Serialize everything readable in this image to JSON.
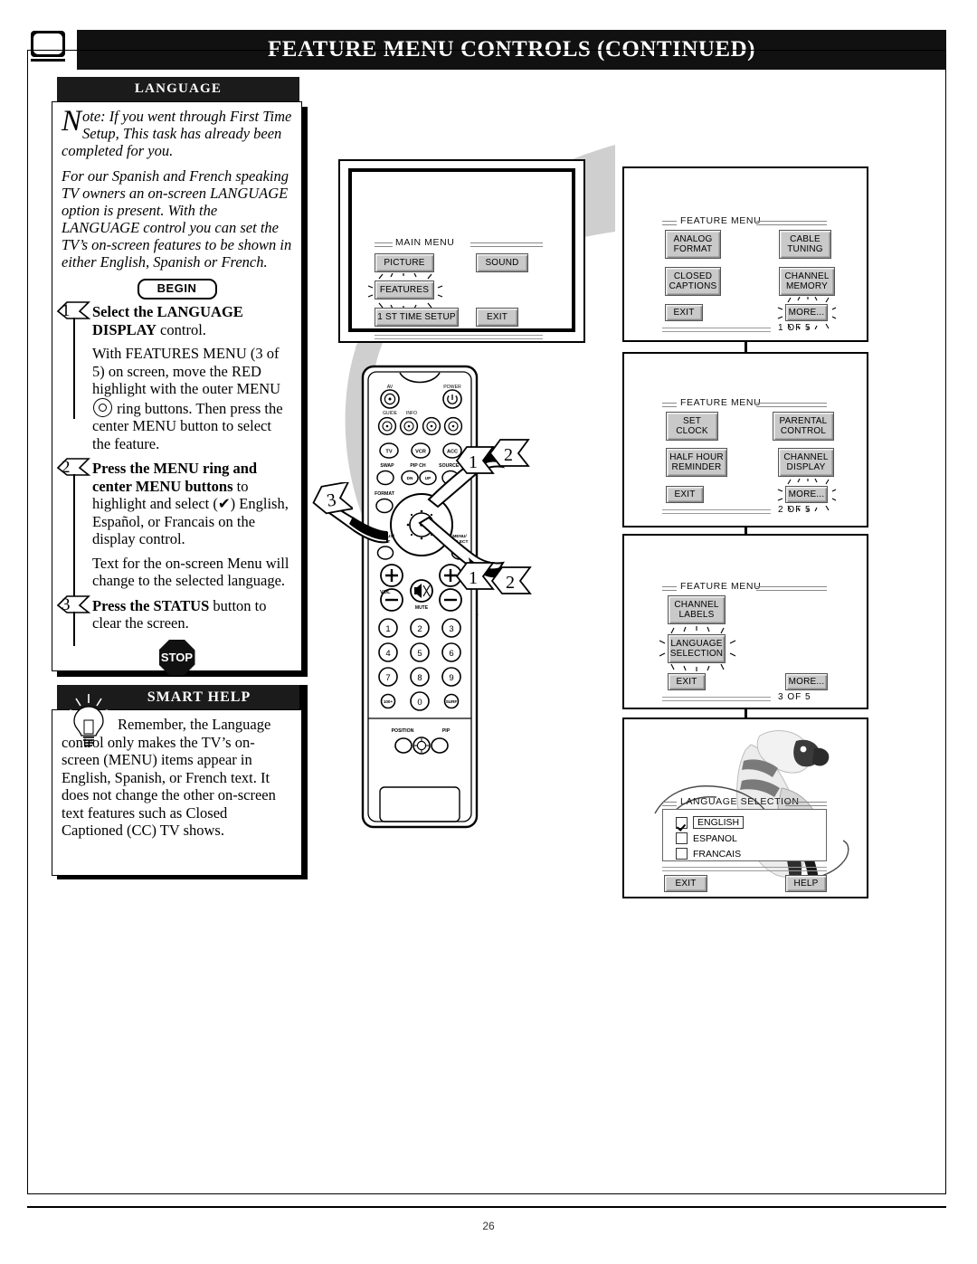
{
  "page": {
    "number": "26",
    "header_title": "FEATURE MENU CONTROLS (CONTINUED)",
    "corner_icon": "tv-icon"
  },
  "language_panel": {
    "title": "LANGUAGE",
    "note_dropcap": "N",
    "note_text": "ote: If you went through First Time Setup, This task has already been completed for you.",
    "intro_text": "For our Spanish and French speaking TV owners an on-screen LANGUAGE option is present. With the LANGUAGE control you can set the TV’s on-screen features to be shown in either English, Spanish or French.",
    "begin_label": "BEGIN",
    "stop_label": "STOP",
    "steps": [
      {
        "number": "1",
        "heading_bold": "Select the LANGUAGE DISPLAY",
        "heading_rest": " control.",
        "body_a": "With FEATURES MENU (3 of 5) on screen, move the RED highlight with the outer MENU ",
        "body_b": " ring buttons. Then press the center MENU button to select the feature."
      },
      {
        "number": "2",
        "heading_bold": "Press the MENU ring and center MENU buttons",
        "heading_rest": " to highlight and select (✔) English, Español, or Francais on the display control.",
        "body_a": "Text for the on-screen Menu will change to the selected language.",
        "body_b": ""
      },
      {
        "number": "3",
        "heading_bold": "Press the STATUS",
        "heading_rest": " button to clear the screen.",
        "body_a": "",
        "body_b": ""
      }
    ]
  },
  "smart_help": {
    "title": "SMART HELP",
    "icon": "lightbulb-icon",
    "text": "Remember, the Language control only makes the TV’s on-screen (MENU) items appear in English, Spanish, or French text. It does not change the other on-screen text features such as Closed Captioned (CC) TV shows."
  },
  "screens": {
    "main_menu": {
      "title": "MAIN MENU",
      "buttons": [
        {
          "label": "PICTURE",
          "highlighted": false
        },
        {
          "label": "SOUND",
          "highlighted": false
        },
        {
          "label": "FEATURES",
          "highlighted": true
        },
        {
          "label": "1 ST TIME SETUP",
          "highlighted": false
        },
        {
          "label": "EXIT",
          "highlighted": false
        }
      ]
    },
    "feature_menu_1": {
      "title": "FEATURE MENU",
      "page_indicator": "1 OF 5",
      "buttons": [
        {
          "label": "ANALOG FORMAT",
          "highlighted": false
        },
        {
          "label": "CABLE TUNING",
          "highlighted": false
        },
        {
          "label": "CLOSED CAPTIONS",
          "highlighted": false
        },
        {
          "label": "CHANNEL MEMORY",
          "highlighted": false
        },
        {
          "label": "EXIT",
          "highlighted": false
        },
        {
          "label": "MORE...",
          "highlighted": true
        }
      ]
    },
    "feature_menu_2": {
      "title": "FEATURE MENU",
      "page_indicator": "2 OF 5",
      "buttons": [
        {
          "label": "SET CLOCK",
          "highlighted": false
        },
        {
          "label": "PARENTAL CONTROL",
          "highlighted": false
        },
        {
          "label": "HALF HOUR REMINDER",
          "highlighted": false
        },
        {
          "label": "CHANNEL DISPLAY",
          "highlighted": false
        },
        {
          "label": "EXIT",
          "highlighted": false
        },
        {
          "label": "MORE...",
          "highlighted": true
        }
      ]
    },
    "feature_menu_3": {
      "title": "FEATURE MENU",
      "page_indicator": "3 OF 5",
      "buttons": [
        {
          "label": "CHANNEL LABELS",
          "highlighted": false
        },
        {
          "label": "LANGUAGE SELECTION",
          "highlighted": true
        },
        {
          "label": "EXIT",
          "highlighted": false
        },
        {
          "label": "MORE...",
          "highlighted": false
        }
      ]
    },
    "language_selection": {
      "title": "LANGUAGE SELECTION",
      "options": [
        {
          "label": "ENGLISH",
          "checked": true
        },
        {
          "label": "ESPANOL",
          "checked": false
        },
        {
          "label": "FRANCAIS",
          "checked": false
        }
      ],
      "exit_label": "EXIT",
      "help_label": "HELP",
      "decoration": "parrot-illustration"
    }
  },
  "remote": {
    "labels": {
      "av": "AV",
      "power": "POWER",
      "guide": "GUIDE",
      "info": "INFO",
      "tv": "TV",
      "vcr": "VCR",
      "acc": "ACC",
      "swap": "SWAP",
      "pip_ch": "PIP CH",
      "source": "SOURCE FRZ",
      "dn": "DN",
      "up": "UP",
      "format": "FORMAT",
      "status_exit": "STATUS/ EXIT",
      "menu_select": "MENU/ SELECT",
      "vol": "VOL",
      "mute": "MUTE",
      "position": "POSITION",
      "pip": "PIP",
      "hundred": "100+",
      "surf": "SURF"
    },
    "keypad": [
      "1",
      "2",
      "3",
      "4",
      "5",
      "6",
      "7",
      "8",
      "9",
      "0"
    ]
  },
  "callouts": [
    {
      "label": "1"
    },
    {
      "label": "2"
    },
    {
      "label": "3"
    },
    {
      "label": "1"
    },
    {
      "label": "2"
    }
  ]
}
